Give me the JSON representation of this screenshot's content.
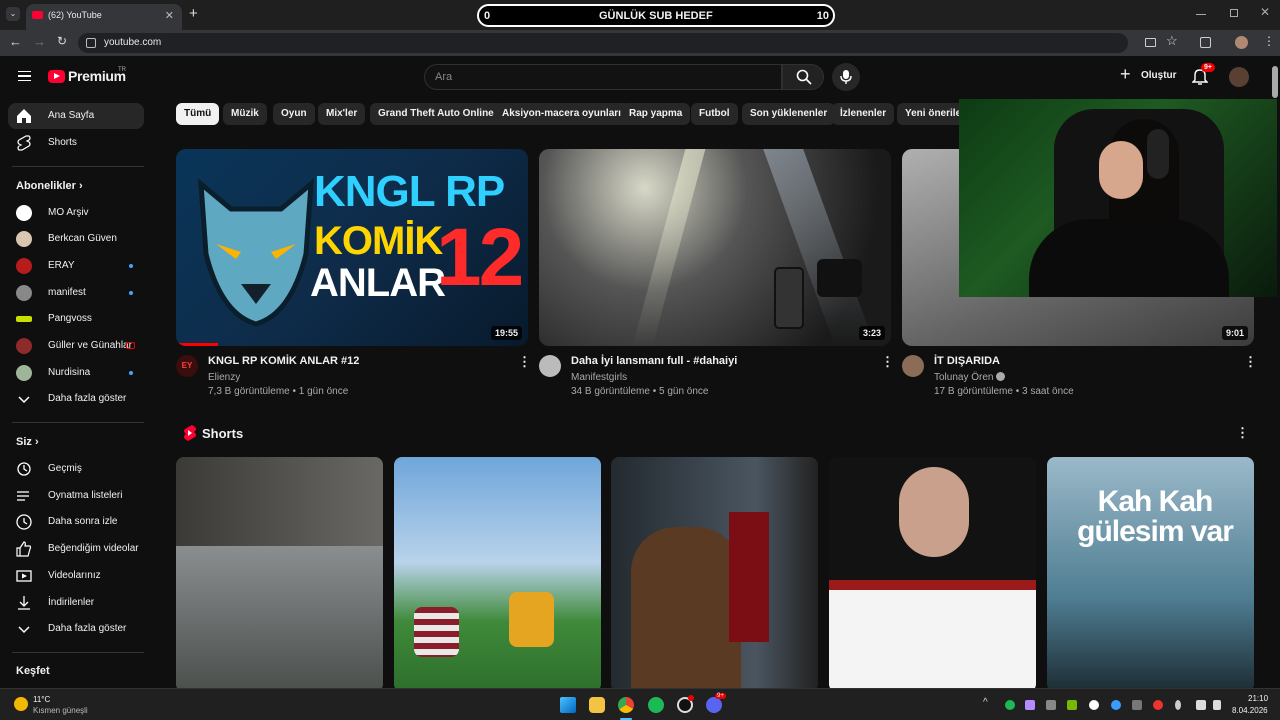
{
  "browser": {
    "tab_title": "(62) YouTube",
    "tab_close": "✕",
    "new_tab": "+",
    "url": "youtube.com",
    "overlay": {
      "left": "0",
      "title": "GÜNLÜK SUB HEDEF",
      "right": "10"
    }
  },
  "header": {
    "logo": "Premium",
    "logo_tr": "TR",
    "search_placeholder": "Ara",
    "create_label": "Oluştur",
    "notification_count": "9+"
  },
  "sidebar": {
    "main": [
      {
        "label": "Ana Sayfa",
        "icon": "home-icon"
      },
      {
        "label": "Shorts",
        "icon": "shorts-icon"
      }
    ],
    "subs_title": "Abonelikler",
    "subs": [
      {
        "label": "MO Arşiv",
        "color": "#ffffff",
        "dot": false
      },
      {
        "label": "Berkcan Güven",
        "color": "#d9c5b0",
        "dot": false
      },
      {
        "label": "ERAY",
        "color": "#b71c1c",
        "dot": true
      },
      {
        "label": "manifest",
        "color": "#888888",
        "dot": true
      },
      {
        "label": "Pangvoss",
        "color": "#c6e000",
        "dot": false
      },
      {
        "label": "Güller ve Günahlar",
        "color": "#8e2a2a",
        "dot": false
      },
      {
        "label": "Nurdisina",
        "color": "#9fb59a",
        "dot": true
      }
    ],
    "subs_more": "Daha fazla göster",
    "you_title": "Siz",
    "you": [
      {
        "label": "Geçmiş",
        "icon": "history-icon"
      },
      {
        "label": "Oynatma listeleri",
        "icon": "playlist-icon"
      },
      {
        "label": "Daha sonra izle",
        "icon": "clock-icon"
      },
      {
        "label": "Beğendiğim videolar",
        "icon": "like-icon"
      },
      {
        "label": "Videolarınız",
        "icon": "video-icon"
      },
      {
        "label": "İndirilenler",
        "icon": "download-icon"
      },
      {
        "label": "Daha fazla göster",
        "icon": "chevron-down-icon"
      }
    ],
    "explore_title": "Keşfet"
  },
  "chips": [
    "Tümü",
    "Müzik",
    "Oyun",
    "Mix'ler",
    "Grand Theft Auto Online",
    "Aksiyon-macera oyunları",
    "Rap yapma",
    "Futbol",
    "Son yüklenenler",
    "İzlenenler",
    "Yeni öneriler"
  ],
  "videos": [
    {
      "title": "KNGL RP KOMİK ANLAR #12",
      "channel": "Elienzy",
      "meta": "7,3 B görüntüleme • 1 gün önce",
      "duration": "19:55",
      "thumb_l1": "KNGL RP",
      "thumb_l2": "KOMİK",
      "thumb_l3": "ANLAR",
      "thumb_num": "12",
      "avatar_text": "EY"
    },
    {
      "title": "Daha İyi lansmanı full - #dahaiyi",
      "channel": "Manifestgirls",
      "meta": "34 B görüntüleme • 5 gün önce",
      "duration": "3:23"
    },
    {
      "title": "İT DIŞARIDA",
      "channel": "Tolunay Ören",
      "meta": "17 B görüntüleme • 3 saat önce",
      "duration": "9:01"
    }
  ],
  "shorts": {
    "title": "Shorts",
    "card5_text": "Kah Kah gülesim var"
  },
  "taskbar": {
    "weather_temp": "11°C",
    "weather_desc": "Kısmen güneşli",
    "time": "21:10",
    "date": "8.04.2026",
    "discord_badge": "9+"
  }
}
